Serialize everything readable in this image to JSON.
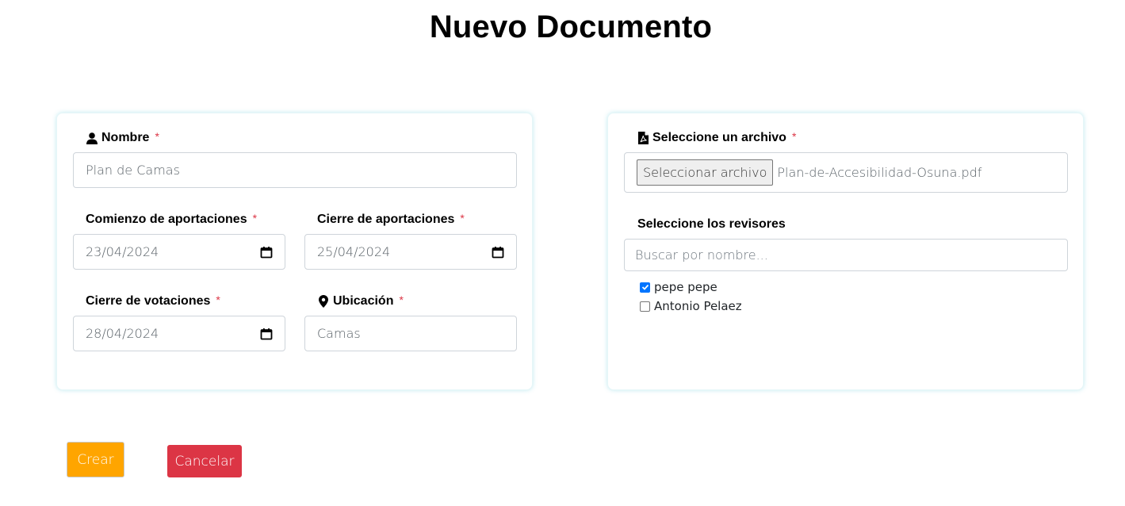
{
  "title": "Nuevo Documento",
  "form": {
    "nombre": {
      "label": "Nombre",
      "required_mark": "*",
      "value": "Plan de Camas"
    },
    "comienzo_aportaciones": {
      "label": "Comienzo de aportaciones",
      "required_mark": "*",
      "value": "23/04/2024"
    },
    "cierre_aportaciones": {
      "label": "Cierre de aportaciones",
      "required_mark": "*",
      "value": "25/04/2024"
    },
    "cierre_votaciones": {
      "label": "Cierre de votaciones",
      "required_mark": "*",
      "value": "28/04/2024"
    },
    "ubicacion": {
      "label": "Ubicación",
      "required_mark": "*",
      "value": "Camas"
    }
  },
  "file": {
    "label": "Seleccione un archivo",
    "required_mark": "*",
    "button_label": "Seleccionar archivo",
    "file_name": "Plan-de-Accesibilidad-Osuna.pdf"
  },
  "reviewers": {
    "label": "Seleccione los revisores",
    "search_placeholder": "Buscar por nombre...",
    "items": [
      {
        "name": "pepe pepe",
        "checked": true
      },
      {
        "name": "Antonio Pelaez",
        "checked": false
      }
    ]
  },
  "actions": {
    "create_label": "Crear",
    "cancel_label": "Cancelar"
  },
  "icons": {
    "nombre": "user-icon",
    "ubicacion": "map-marker-icon",
    "archivo": "file-pdf-icon",
    "date": "calendar-icon"
  },
  "colors": {
    "required": "#dc3545",
    "create_button": "#ffa500",
    "cancel_button": "#dc3545",
    "checkbox_checked": "#0075ff"
  }
}
